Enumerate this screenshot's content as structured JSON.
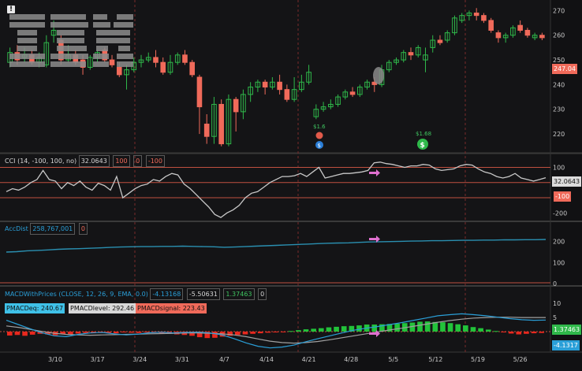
{
  "price_panel": {
    "price_tag": "247.04",
    "dividend_labels": [
      "$1.6",
      "$1.68"
    ],
    "event_icon_letters": [
      "$",
      "$"
    ]
  },
  "cci": {
    "title": "CCI (14, -100, 100, no)",
    "value": "32.0643",
    "upper": "100",
    "zero": "0",
    "lower": "-100",
    "tag_value": "32.0643",
    "tag_lower": "-100"
  },
  "accdist": {
    "title": "AccDist",
    "value": "258,767,001",
    "zero": "0"
  },
  "macd": {
    "title": "MACDWithPrices (CLOSE, 12, 26, 9, EMA, 0.0)",
    "v1": "-4.13168",
    "v2": "-5.50631",
    "v3": "1.37463",
    "zero": "0",
    "pmac_deq": "PMACDeq: 240.67",
    "pmac_level": "PMACDlevel: 292.46",
    "pmac_signal": "PMACDsignal: 223.43",
    "tag_hist": "1.37463",
    "tag_line": "-4.1317"
  },
  "colors": {
    "up": "#2fb84a",
    "down": "#f06a5a",
    "cci_line": "#c8c8c8",
    "acc_line": "#2a8fb0",
    "macd_line": "#2a9fd8",
    "signal_line": "#a0a0a0",
    "ref_line": "#c05040",
    "arrow": "#e070d0"
  },
  "chart_data": [
    {
      "type": "candlestick",
      "title": "",
      "x": [
        "3/10",
        "3/17",
        "3/24",
        "3/31",
        "4/7",
        "4/14",
        "4/21",
        "4/28",
        "5/5",
        "5/12",
        "5/19",
        "5/26"
      ],
      "y_ticks": [
        220,
        230,
        240,
        250,
        260,
        270
      ],
      "ylim": [
        213,
        273
      ],
      "last_price": 247.04,
      "candles": [
        {
          "o": 249,
          "c": 253,
          "h": 255,
          "l": 247
        },
        {
          "o": 253,
          "c": 250,
          "h": 256,
          "l": 248
        },
        {
          "o": 251,
          "c": 252,
          "h": 255,
          "l": 249
        },
        {
          "o": 252,
          "c": 249,
          "h": 254,
          "l": 248
        },
        {
          "o": 249,
          "c": 251,
          "h": 253,
          "l": 247
        },
        {
          "o": 248,
          "c": 257,
          "h": 260,
          "l": 247
        },
        {
          "o": 260,
          "c": 262,
          "h": 266,
          "l": 257
        },
        {
          "o": 258,
          "c": 250,
          "h": 260,
          "l": 248
        },
        {
          "o": 250,
          "c": 252,
          "h": 256,
          "l": 249
        },
        {
          "o": 252,
          "c": 249,
          "h": 254,
          "l": 248
        },
        {
          "o": 250,
          "c": 247,
          "h": 252,
          "l": 244
        },
        {
          "o": 247,
          "c": 251,
          "h": 252,
          "l": 246
        },
        {
          "o": 251,
          "c": 253,
          "h": 254,
          "l": 249
        },
        {
          "o": 254,
          "c": 250,
          "h": 255,
          "l": 249
        },
        {
          "o": 250,
          "c": 248,
          "h": 252,
          "l": 247
        },
        {
          "o": 247,
          "c": 244,
          "h": 249,
          "l": 243
        },
        {
          "o": 244,
          "c": 246,
          "h": 248,
          "l": 238
        },
        {
          "o": 246,
          "c": 249,
          "h": 251,
          "l": 245
        },
        {
          "o": 249,
          "c": 250,
          "h": 252,
          "l": 247
        },
        {
          "o": 250,
          "c": 251,
          "h": 253,
          "l": 249
        },
        {
          "o": 251,
          "c": 249,
          "h": 254,
          "l": 247
        },
        {
          "o": 249,
          "c": 245,
          "h": 251,
          "l": 244
        },
        {
          "o": 245,
          "c": 249,
          "h": 252,
          "l": 244
        },
        {
          "o": 249,
          "c": 252,
          "h": 253,
          "l": 248
        },
        {
          "o": 252,
          "c": 249,
          "h": 254,
          "l": 248
        },
        {
          "o": 249,
          "c": 244,
          "h": 250,
          "l": 243
        },
        {
          "o": 243,
          "c": 231,
          "h": 244,
          "l": 220
        },
        {
          "o": 224,
          "c": 219,
          "h": 228,
          "l": 216
        },
        {
          "o": 219,
          "c": 232,
          "h": 235,
          "l": 216
        },
        {
          "o": 232,
          "c": 216,
          "h": 234,
          "l": 215
        },
        {
          "o": 216,
          "c": 234,
          "h": 236,
          "l": 215
        },
        {
          "o": 234,
          "c": 229,
          "h": 235,
          "l": 221
        },
        {
          "o": 229,
          "c": 236,
          "h": 238,
          "l": 226
        },
        {
          "o": 236,
          "c": 239,
          "h": 241,
          "l": 233
        },
        {
          "o": 239,
          "c": 241,
          "h": 242,
          "l": 237
        },
        {
          "o": 241,
          "c": 239,
          "h": 242,
          "l": 236
        },
        {
          "o": 239,
          "c": 241,
          "h": 243,
          "l": 238
        },
        {
          "o": 241,
          "c": 238,
          "h": 244,
          "l": 236
        },
        {
          "o": 238,
          "c": 234,
          "h": 240,
          "l": 233
        },
        {
          "o": 234,
          "c": 238,
          "h": 243,
          "l": 233
        },
        {
          "o": 238,
          "c": 241,
          "h": 244,
          "l": 237
        },
        {
          "o": 241,
          "c": 245,
          "h": 248,
          "l": 240
        },
        {
          "o": 227,
          "c": 230,
          "h": 232,
          "l": 226
        },
        {
          "o": 230,
          "c": 231,
          "h": 233,
          "l": 229
        },
        {
          "o": 231,
          "c": 232,
          "h": 234,
          "l": 230
        },
        {
          "o": 232,
          "c": 235,
          "h": 236,
          "l": 231
        },
        {
          "o": 235,
          "c": 237,
          "h": 238,
          "l": 234
        },
        {
          "o": 237,
          "c": 236,
          "h": 239,
          "l": 235
        },
        {
          "o": 236,
          "c": 239,
          "h": 240,
          "l": 235
        },
        {
          "o": 239,
          "c": 241,
          "h": 242,
          "l": 238
        },
        {
          "o": 241,
          "c": 240,
          "h": 243,
          "l": 237
        },
        {
          "o": 240,
          "c": 246,
          "h": 248,
          "l": 239
        },
        {
          "o": 246,
          "c": 249,
          "h": 250,
          "l": 245
        },
        {
          "o": 249,
          "c": 250,
          "h": 251,
          "l": 248
        },
        {
          "o": 250,
          "c": 253,
          "h": 254,
          "l": 249
        },
        {
          "o": 253,
          "c": 252,
          "h": 255,
          "l": 250
        },
        {
          "o": 252,
          "c": 255,
          "h": 256,
          "l": 251
        },
        {
          "o": 250,
          "c": 252,
          "h": 255,
          "l": 245
        },
        {
          "o": 255,
          "c": 258,
          "h": 260,
          "l": 253
        },
        {
          "o": 258,
          "c": 257,
          "h": 260,
          "l": 256
        },
        {
          "o": 258,
          "c": 261,
          "h": 262,
          "l": 257
        },
        {
          "o": 261,
          "c": 267,
          "h": 268,
          "l": 260
        },
        {
          "o": 266,
          "c": 268,
          "h": 269,
          "l": 265
        },
        {
          "o": 268,
          "c": 269,
          "h": 270,
          "l": 266
        },
        {
          "o": 269,
          "c": 268,
          "h": 271,
          "l": 266
        },
        {
          "o": 268,
          "c": 266,
          "h": 269,
          "l": 265
        },
        {
          "o": 266,
          "c": 262,
          "h": 267,
          "l": 261
        },
        {
          "o": 261,
          "c": 259,
          "h": 262,
          "l": 257
        },
        {
          "o": 259,
          "c": 260,
          "h": 261,
          "l": 257
        },
        {
          "o": 260,
          "c": 263,
          "h": 264,
          "l": 259
        },
        {
          "o": 264,
          "c": 262,
          "h": 266,
          "l": 261
        },
        {
          "o": 262,
          "c": 260,
          "h": 263,
          "l": 259
        },
        {
          "o": 259,
          "c": 260,
          "h": 261,
          "l": 258
        },
        {
          "o": 260,
          "c": 259,
          "h": 261,
          "l": 258
        }
      ]
    },
    {
      "type": "line",
      "title": "CCI (14, -100, 100, no)",
      "y_ticks": [
        100,
        0,
        -100,
        -200
      ],
      "ylim": [
        -240,
        165
      ],
      "reference_levels": [
        100,
        0,
        -100
      ],
      "values": [
        -60,
        -40,
        -50,
        -30,
        0,
        20,
        80,
        20,
        10,
        -40,
        0,
        -20,
        10,
        -30,
        -50,
        -5,
        -20,
        -50,
        40,
        -100,
        -70,
        -40,
        -20,
        -10,
        20,
        10,
        40,
        60,
        50,
        -10,
        -40,
        -80,
        -120,
        -160,
        -210,
        -230,
        -200,
        -180,
        -150,
        -100,
        -70,
        -60,
        -30,
        0,
        20,
        40,
        40,
        45,
        60,
        40,
        70,
        100,
        30,
        40,
        50,
        60,
        60,
        65,
        70,
        80,
        130,
        135,
        125,
        120,
        110,
        100,
        110,
        110,
        120,
        115,
        90,
        80,
        85,
        90,
        110,
        120,
        115,
        90,
        70,
        60,
        40,
        30,
        40,
        60,
        30,
        20,
        10,
        20,
        32.06
      ]
    },
    {
      "type": "line",
      "title": "AccDist",
      "y_ticks": [
        200,
        100,
        0
      ],
      "ylim": [
        0,
        240
      ],
      "values": [
        150,
        152,
        156,
        158,
        160,
        163,
        165,
        166,
        168,
        170,
        172,
        174,
        175,
        176,
        176,
        177,
        177,
        178,
        177,
        176,
        175,
        173,
        174,
        176,
        178,
        180,
        182,
        184,
        186,
        188,
        190,
        192,
        193,
        194,
        196,
        198,
        199,
        200,
        201,
        202,
        203,
        204,
        204,
        205,
        206,
        206,
        207,
        207,
        208,
        208,
        209,
        209,
        210
      ]
    },
    {
      "type": "bar",
      "title": "MACDWithPrices (CLOSE, 12, 26, 9, EMA, 0.0)",
      "y_ticks": [
        10,
        5,
        0,
        -5
      ],
      "ylim": [
        -7,
        12
      ],
      "series": [
        {
          "name": "Diff",
          "values": [
            -1.4,
            -1.2,
            -1.5,
            -1.1,
            -0.8,
            -1.0,
            -1.3,
            -0.9,
            -1.0,
            -0.7,
            -0.5,
            -0.6,
            -0.4,
            -0.5,
            -0.6,
            -0.3,
            -0.4,
            -0.5,
            -0.2,
            -0.3,
            -0.6,
            -0.8,
            -1.0,
            -1.2,
            -1.5,
            -2.0,
            -2.3,
            -2.2,
            -1.8,
            -1.5,
            -1.2,
            -1.0,
            -0.8,
            -0.6,
            -0.4,
            -0.3,
            -0.2,
            0.2,
            0.5,
            0.8,
            1.0,
            1.2,
            1.5,
            1.7,
            1.9,
            2.0,
            2.2,
            2.5,
            2.5,
            2.6,
            2.7,
            2.8,
            3.0,
            3.2,
            3.5,
            3.6,
            3.4,
            3.3,
            3.0,
            2.6,
            2.2,
            1.6,
            1.2,
            0.7,
            0.2,
            -0.3,
            -0.7,
            -1.0,
            -0.8,
            -0.6,
            -0.5
          ]
        },
        {
          "name": "Value",
          "values": [
            4,
            2.5,
            1.0,
            -0.5,
            -1.5,
            -1.8,
            -1.0,
            -0.5,
            -0.3,
            -0.8,
            -1.2,
            -0.9,
            -0.4,
            -0.2,
            -0.5,
            -0.3,
            -0.2,
            -0.5,
            -1.2,
            -2.5,
            -4.0,
            -5.2,
            -5.8,
            -5.5,
            -4.8,
            -3.6,
            -2.5,
            -1.5,
            -0.5,
            0.5,
            1.2,
            1.8,
            2.5,
            3.2,
            4.0,
            4.8,
            5.6,
            6.0,
            6.3,
            6.0,
            5.6,
            5.1,
            4.6,
            4.2,
            4.0,
            4.1
          ]
        },
        {
          "name": "Avg",
          "values": [
            2,
            1.5,
            0.8,
            0,
            -0.6,
            -1.0,
            -1.2,
            -1.3,
            -1.2,
            -1.1,
            -1.0,
            -0.9,
            -0.8,
            -0.7,
            -0.6,
            -0.5,
            -0.5,
            -0.6,
            -0.8,
            -1.2,
            -1.8,
            -2.6,
            -3.4,
            -3.9,
            -4.1,
            -3.9,
            -3.5,
            -2.9,
            -2.2,
            -1.5,
            -0.8,
            -0.1,
            0.6,
            1.2,
            1.9,
            2.6,
            3.3,
            3.9,
            4.4,
            4.8,
            5.0,
            5.1,
            5.1,
            5.0,
            5.0,
            5.0
          ]
        }
      ]
    }
  ]
}
